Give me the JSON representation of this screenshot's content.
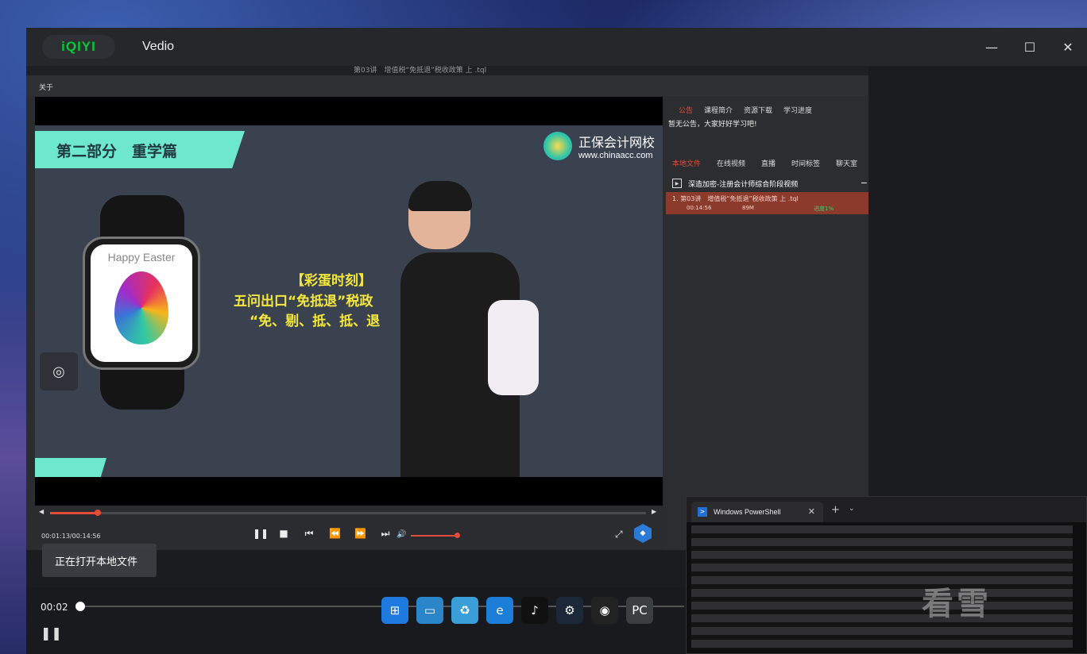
{
  "window": {
    "brand": "iQIYI",
    "title": "Vedio"
  },
  "window_controls": {
    "minimize": "—",
    "maximize": "☐",
    "close": "✕"
  },
  "inner": {
    "title": "第03讲　增值税“免抵退”税收政策 上 .tql",
    "menu": "关于"
  },
  "video": {
    "banner": "第二部分　重学篇",
    "brand_name": "正保会计网校",
    "brand_url": "www.chinaacc.com",
    "watch_text": "Happy Easter",
    "board_title": "【彩蛋时刻】",
    "board_line1": "五问出口“免抵退”税政",
    "board_line2": "“免、剔、抵、抵、退"
  },
  "side": {
    "tabs": [
      {
        "label": "公告",
        "active": true
      },
      {
        "label": "课程简介",
        "active": false
      },
      {
        "label": "资源下载",
        "active": false
      },
      {
        "label": "学习进度",
        "active": false
      }
    ],
    "notice": "暂无公告，大家好好学习吧!",
    "tabs2": [
      {
        "label": "本地文件",
        "active": true
      },
      {
        "label": "在线视频",
        "active": false
      },
      {
        "label": "直播",
        "active": false
      },
      {
        "label": "时间标签",
        "active": false
      },
      {
        "label": "聊天室",
        "active": false
      }
    ],
    "group_title": "深造加密-注册会计师综合阶段视频",
    "group_toggle": "−",
    "item": {
      "name": "1. 第03讲　增值税“免抵退”税收政策 上 .tql",
      "duration": "00:14:56",
      "size": "89M",
      "progress": "进度1%"
    }
  },
  "controls": {
    "time": "00:01:13/00:14:56",
    "seek_progress": 0.08,
    "volume": 1.0,
    "buttons": [
      "pause",
      "stop",
      "prev",
      "rewind",
      "forward",
      "next"
    ]
  },
  "toast": "正在打开本地文件",
  "iq_bottom": {
    "time": "00:02",
    "pause_icon": "❚❚"
  },
  "powershell": {
    "tab": "Windows PowerShell",
    "close": "✕",
    "plus": "+",
    "drop": "⌄"
  },
  "watermark": "看雪",
  "colors": {
    "accent": "#e34c3a",
    "iqiyi_green": "#00cc36",
    "banner": "#6ee8cc",
    "board_text": "#f5e83a"
  }
}
